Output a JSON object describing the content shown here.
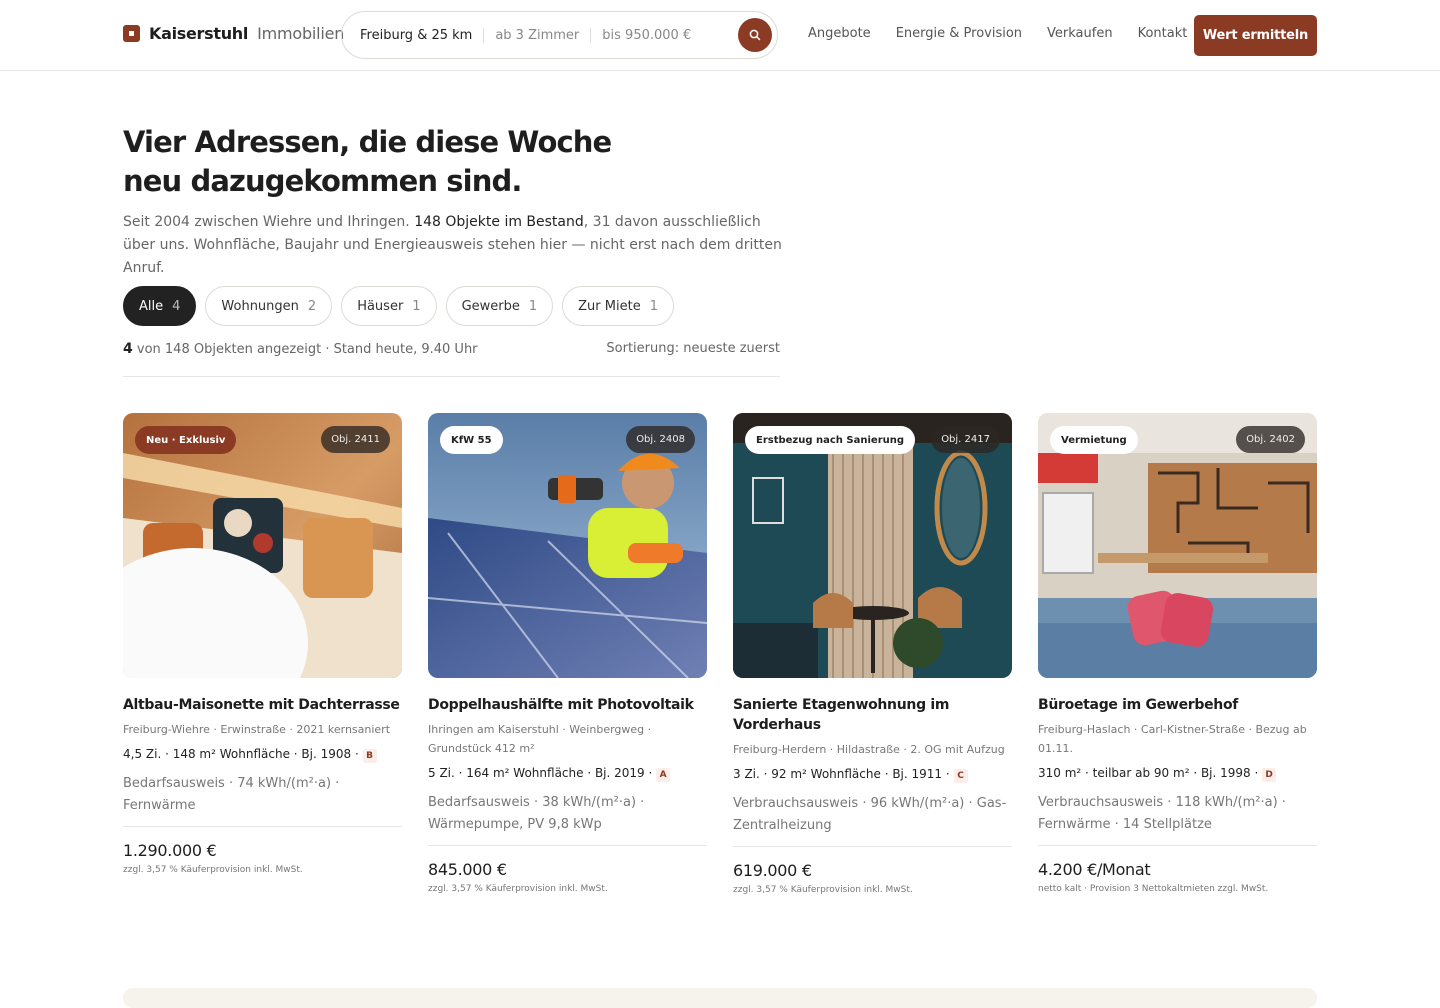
{
  "header": {
    "logo_name": "Kaiserstuhl",
    "logo_sub": "Immobilien",
    "search_location": "Freiburg & 25 km",
    "search_rooms": "ab 3 Zimmer",
    "search_price": "bis 950.000 €",
    "search_icon": "search-icon",
    "nav": [
      "Angebote",
      "Energie & Provision",
      "Verkaufen",
      "Kontakt"
    ],
    "cta": "Wert ermitteln"
  },
  "hero": {
    "title_line1": "Vier Adressen, die diese Woche",
    "title_line2": "neu dazugekommen sind.",
    "intro_a": "Seit 2004 zwischen Wiehre und Ihringen. ",
    "intro_b": "148 Objekte im Bestand",
    "intro_c": ", 31 davon ausschließlich über uns. Wohnfläche, Baujahr und Energieausweis stehen hier — nicht erst nach dem dritten Anruf."
  },
  "filters": [
    {
      "label": "Alle",
      "count": "4",
      "active": true
    },
    {
      "label": "Wohnungen",
      "count": "2"
    },
    {
      "label": "Häuser",
      "count": "1"
    },
    {
      "label": "Gewerbe",
      "count": "1"
    },
    {
      "label": "Zur Miete",
      "count": "1"
    }
  ],
  "meta": {
    "count": "4",
    "count_text": "von 148 Objekten angezeigt · Stand heute, 9.40 Uhr",
    "sort": "Sortierung: neueste zuerst"
  },
  "colors": {
    "accent": "#8b3a23",
    "dark": "#222222"
  },
  "cards": [
    {
      "tag": "Neu · Exklusiv",
      "obj": "Obj. 2411",
      "title": "Altbau-Maisonette mit Dachterrasse",
      "location": "Freiburg-Wiehre · Erwinstraße · 2021 kernsaniert",
      "facts": "4,5 Zi.  ·  148 m² Wohnfläche  ·  Bj. 1908  · ",
      "eclass": "B",
      "energy": "Bedarfsausweis · 74 kWh/(m²·a) · Fernwärme",
      "price": "1.290.000 €",
      "fee": "zzgl. 3,57 % Käuferprovision inkl. MwSt."
    },
    {
      "tag": "KfW 55",
      "obj": "Obj. 2408",
      "title": "Doppelhaushälfte mit Photovoltaik",
      "location": "Ihringen am Kaiserstuhl · Weinbergweg · Grundstück 412 m²",
      "facts": "5 Zi.  ·  164 m² Wohnfläche  ·  Bj. 2019  · ",
      "eclass": "A",
      "energy": "Bedarfsausweis · 38 kWh/(m²·a) · Wärmepumpe, PV 9,8 kWp",
      "price": "845.000 €",
      "fee": "zzgl. 3,57 % Käuferprovision inkl. MwSt."
    },
    {
      "tag": "Erstbezug nach Sanierung",
      "obj": "Obj. 2417",
      "title": "Sanierte Etagenwohnung im Vorderhaus",
      "location": "Freiburg-Herdern · Hildastraße · 2. OG mit Aufzug",
      "facts": "3 Zi.  ·  92 m² Wohnfläche  ·  Bj. 1911  · ",
      "eclass": "C",
      "energy": "Verbrauchsausweis · 96 kWh/(m²·a) · Gas-Zentralheizung",
      "price": "619.000 €",
      "fee": "zzgl. 3,57 % Käuferprovision inkl. MwSt."
    },
    {
      "tag": "Vermietung",
      "obj": "Obj. 2402",
      "title": "Büroetage im Gewerbehof",
      "location": "Freiburg-Haslach · Carl-Kistner-Straße · Bezug ab 01.11.",
      "facts": "310 m²  ·  teilbar ab 90 m²  ·  Bj. 1998  · ",
      "eclass": "D",
      "energy": "Verbrauchsausweis · 118 kWh/(m²·a) · Fernwärme · 14 Stellplätze",
      "price": "4.200 €/Monat",
      "fee": "netto kalt · Provision 3 Nettokaltmieten zzgl. MwSt."
    }
  ]
}
